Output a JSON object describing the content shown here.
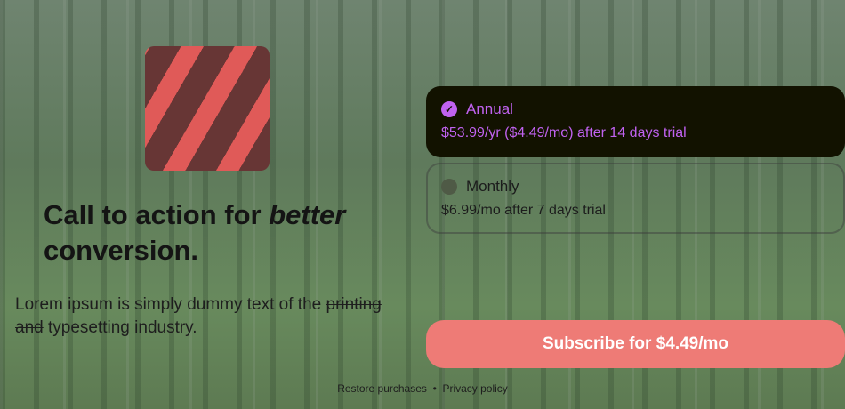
{
  "headline": {
    "prefix": "Call to action for ",
    "emph": "better",
    "suffix": "conversion."
  },
  "body": {
    "text1": "Lorem ipsum is simply dummy text of the ",
    "strike1": "printing",
    "strike2": "and",
    "text2": " typesetting industry."
  },
  "plans": [
    {
      "name": "Annual",
      "price": "$53.99/yr ($4.49/mo) after 14 days trial",
      "selected": true
    },
    {
      "name": "Monthly",
      "price": "$6.99/mo after 7 days trial",
      "selected": false
    }
  ],
  "subscribe_label": "Subscribe for $4.49/mo",
  "footer": {
    "restore": "Restore purchases",
    "sep": "•",
    "privacy": "Privacy policy"
  },
  "colors": {
    "accent": "#c062f0",
    "button": "#ee7b76"
  }
}
